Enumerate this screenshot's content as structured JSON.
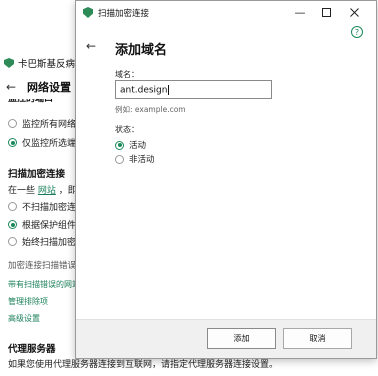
{
  "background": {
    "app_title": "卡巴斯基反病",
    "page_title": "网络设置",
    "section_clipped": "监控的端口",
    "ports_options": [
      "监控所有网络",
      "仅监控所选端"
    ],
    "encrypted_heading": "扫描加密连接",
    "encrypted_intro_pre": "在一些",
    "encrypted_intro_link": "网站",
    "encrypted_intro_post": "，即使",
    "encrypted_options": [
      "不扫描加密连",
      "根据保护组件",
      "始终扫描加密"
    ],
    "encrypted_error_label": "加密连接扫描错误",
    "links": [
      "带有扫描错误的网站",
      "管理排除项",
      "高级设置"
    ],
    "proxy_heading": "代理服务器",
    "proxy_text": "如果您使用代理服务器连接到互联网，请指定代理服务器连接设置。"
  },
  "dialog": {
    "title": "扫描加密连接",
    "heading": "添加域名",
    "domain_label": "域名：",
    "domain_value": "ant.design",
    "example": "例如: example.com",
    "status_label": "状态：",
    "status_options": [
      "活动",
      "非活动"
    ],
    "add_button": "添加",
    "cancel_button": "取消"
  },
  "colors": {
    "accent": "#1a8a5a",
    "link": "#1a7f5a"
  },
  "icons": {
    "minimize": "minimize-icon",
    "maximize": "maximize-icon",
    "close": "close-icon",
    "help": "help-icon",
    "back": "back-arrow-icon",
    "logo": "kaspersky-shield-icon"
  }
}
